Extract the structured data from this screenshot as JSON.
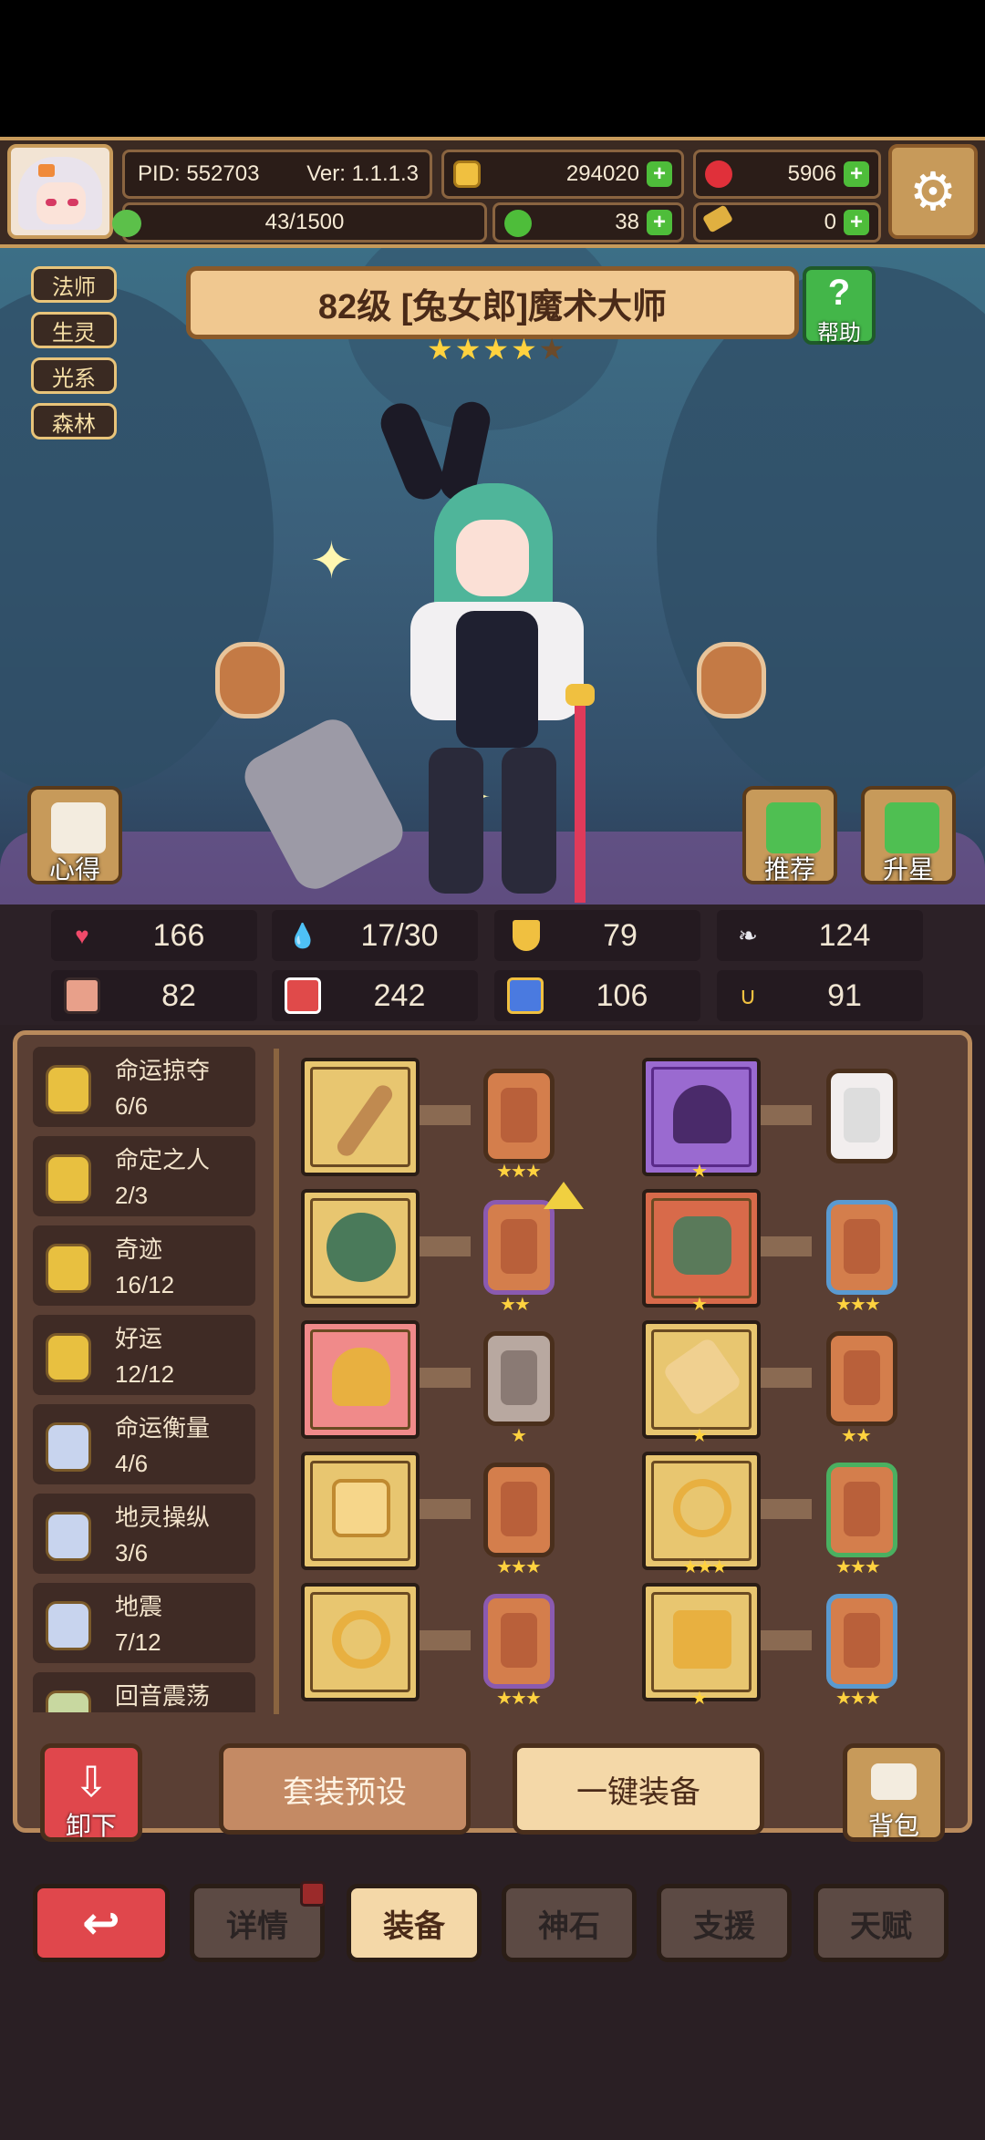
{
  "hud": {
    "pid": "PID: 552703",
    "version": "Ver: 1.1.1.3",
    "gold": "294020",
    "ruby": "5906",
    "stamina": "43/1500",
    "clover": "38",
    "key": "0"
  },
  "tags": [
    "法师",
    "生灵",
    "光系",
    "森林"
  ],
  "hero": {
    "title": "82级 [兔女郎]魔术大师",
    "stars_filled": 4,
    "stars_total": 5,
    "help_label": "帮助",
    "tips_label": "心得",
    "recommend_label": "推荐",
    "upstar_label": "升星"
  },
  "stats": [
    "166",
    "17/30",
    "79",
    "124",
    "82",
    "242",
    "106",
    "91"
  ],
  "sets": [
    {
      "name": "命运掠夺",
      "count": "6/6"
    },
    {
      "name": "命定之人",
      "count": "2/3"
    },
    {
      "name": "奇迹",
      "count": "16/12"
    },
    {
      "name": "好运",
      "count": "12/12"
    },
    {
      "name": "命运衡量",
      "count": "4/6"
    },
    {
      "name": "地灵操纵",
      "count": "3/6"
    },
    {
      "name": "地震",
      "count": "7/12"
    },
    {
      "name": "回音震荡",
      "count": ""
    }
  ],
  "actions": {
    "unequip": "卸下",
    "preset": "套装预设",
    "auto_equip": "一键装备",
    "bag": "背包"
  },
  "tabs": [
    "详情",
    "装备",
    "神石",
    "支援",
    "天赋"
  ],
  "colors": {
    "accent": "#c79a5a",
    "active_tab": "#f4d8a8",
    "back_button": "#e0474c",
    "gem_orange": "#d47e4c",
    "plus_green": "#4ebd3a"
  }
}
